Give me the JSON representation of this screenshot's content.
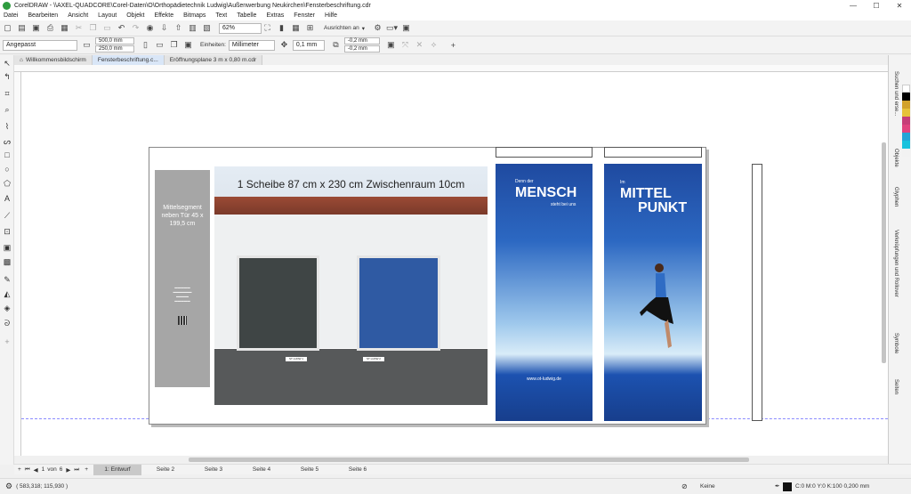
{
  "window": {
    "title": "CorelDRAW - \\\\AXEL-QUADCORE\\Corel-Daten\\O\\Orthopädietechnik Ludwig\\Außenwerbung Neukirchen\\Fensterbeschriftung.cdr",
    "controls": [
      "—",
      "☐",
      "✕"
    ]
  },
  "menu": [
    "Datei",
    "Bearbeiten",
    "Ansicht",
    "Layout",
    "Objekt",
    "Effekte",
    "Bitmaps",
    "Text",
    "Tabelle",
    "Extras",
    "Fenster",
    "Hilfe"
  ],
  "toolbar": {
    "zoom": "62%",
    "snap": "Ausrichten an"
  },
  "propbar": {
    "preset": "Angepasst",
    "width": "500,0 mm",
    "height": "250,0 mm",
    "units_label": "Einheiten:",
    "units": "Millimeter",
    "nudge": "0,1 mm",
    "dup_x": "-0,2 mm",
    "dup_y": "-0,2 mm"
  },
  "doc_tabs": [
    "Willkommensbildschirm",
    "Fensterbeschriftung.c...",
    "Eröffnungsplane 3 m x 0,80 m.cdr"
  ],
  "right_dock": [
    "Suchen und erse...",
    "Objekte",
    "Glyphen",
    "Verknüpfungen und Rollover",
    "Symbole",
    "Seiten"
  ],
  "palette": [
    "#ffffff",
    "#000000",
    "#d2a22a",
    "#e6c23a",
    "#c63d78",
    "#e0437f",
    "#23a4d7",
    "#18c2dd",
    "#f2f2f2"
  ],
  "pages": {
    "current": "1",
    "of_label": "von",
    "total": "6",
    "tabs": [
      "1: Entwurf",
      "Seite 2",
      "Seite 3",
      "Seite 4",
      "Seite 5",
      "Seite 6"
    ]
  },
  "status": {
    "coords": "( 583,318; 115,930 )",
    "fill": "Keine",
    "outline": "C:0 M:0 Y:0 K:100  0,200 mm"
  },
  "artwork": {
    "segment_label": "Mittelsegment neben Tür 45 x 199,5 cm",
    "photo_caption": "1 Scheibe 87 cm x 230 cm Zwischenraum 10cm",
    "banner1_small": "Denn der",
    "banner1_big": "MENSCH",
    "banner1_tag": "steht bei uns",
    "banner2_small": "Im",
    "banner2_big1": "MITTEL",
    "banner2_big2": "PUNKT",
    "url": "www.ot-ludwig.de",
    "plate1": "ST LUDW 1",
    "plate2": "ST LUDW 2"
  }
}
